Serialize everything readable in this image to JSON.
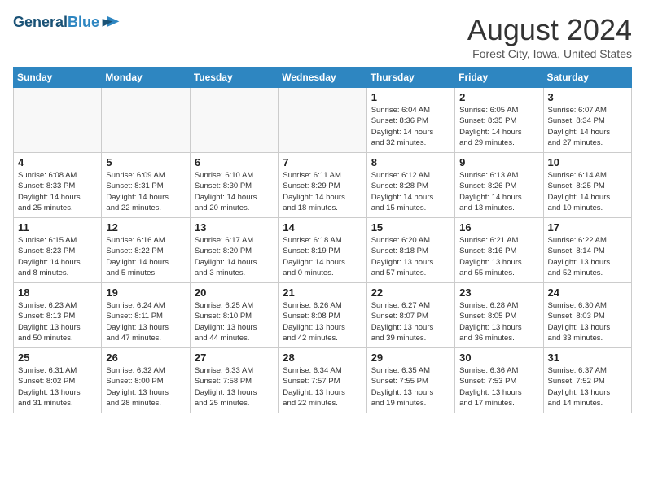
{
  "header": {
    "logo_line1": "General",
    "logo_line2": "Blue",
    "title": "August 2024",
    "location": "Forest City, Iowa, United States"
  },
  "days_of_week": [
    "Sunday",
    "Monday",
    "Tuesday",
    "Wednesday",
    "Thursday",
    "Friday",
    "Saturday"
  ],
  "weeks": [
    [
      {
        "day": "",
        "info": "",
        "empty": true
      },
      {
        "day": "",
        "info": "",
        "empty": true
      },
      {
        "day": "",
        "info": "",
        "empty": true
      },
      {
        "day": "",
        "info": "",
        "empty": true
      },
      {
        "day": "1",
        "info": "Sunrise: 6:04 AM\nSunset: 8:36 PM\nDaylight: 14 hours\nand 32 minutes."
      },
      {
        "day": "2",
        "info": "Sunrise: 6:05 AM\nSunset: 8:35 PM\nDaylight: 14 hours\nand 29 minutes."
      },
      {
        "day": "3",
        "info": "Sunrise: 6:07 AM\nSunset: 8:34 PM\nDaylight: 14 hours\nand 27 minutes."
      }
    ],
    [
      {
        "day": "4",
        "info": "Sunrise: 6:08 AM\nSunset: 8:33 PM\nDaylight: 14 hours\nand 25 minutes."
      },
      {
        "day": "5",
        "info": "Sunrise: 6:09 AM\nSunset: 8:31 PM\nDaylight: 14 hours\nand 22 minutes."
      },
      {
        "day": "6",
        "info": "Sunrise: 6:10 AM\nSunset: 8:30 PM\nDaylight: 14 hours\nand 20 minutes."
      },
      {
        "day": "7",
        "info": "Sunrise: 6:11 AM\nSunset: 8:29 PM\nDaylight: 14 hours\nand 18 minutes."
      },
      {
        "day": "8",
        "info": "Sunrise: 6:12 AM\nSunset: 8:28 PM\nDaylight: 14 hours\nand 15 minutes."
      },
      {
        "day": "9",
        "info": "Sunrise: 6:13 AM\nSunset: 8:26 PM\nDaylight: 14 hours\nand 13 minutes."
      },
      {
        "day": "10",
        "info": "Sunrise: 6:14 AM\nSunset: 8:25 PM\nDaylight: 14 hours\nand 10 minutes."
      }
    ],
    [
      {
        "day": "11",
        "info": "Sunrise: 6:15 AM\nSunset: 8:23 PM\nDaylight: 14 hours\nand 8 minutes."
      },
      {
        "day": "12",
        "info": "Sunrise: 6:16 AM\nSunset: 8:22 PM\nDaylight: 14 hours\nand 5 minutes."
      },
      {
        "day": "13",
        "info": "Sunrise: 6:17 AM\nSunset: 8:20 PM\nDaylight: 14 hours\nand 3 minutes."
      },
      {
        "day": "14",
        "info": "Sunrise: 6:18 AM\nSunset: 8:19 PM\nDaylight: 14 hours\nand 0 minutes."
      },
      {
        "day": "15",
        "info": "Sunrise: 6:20 AM\nSunset: 8:18 PM\nDaylight: 13 hours\nand 57 minutes."
      },
      {
        "day": "16",
        "info": "Sunrise: 6:21 AM\nSunset: 8:16 PM\nDaylight: 13 hours\nand 55 minutes."
      },
      {
        "day": "17",
        "info": "Sunrise: 6:22 AM\nSunset: 8:14 PM\nDaylight: 13 hours\nand 52 minutes."
      }
    ],
    [
      {
        "day": "18",
        "info": "Sunrise: 6:23 AM\nSunset: 8:13 PM\nDaylight: 13 hours\nand 50 minutes."
      },
      {
        "day": "19",
        "info": "Sunrise: 6:24 AM\nSunset: 8:11 PM\nDaylight: 13 hours\nand 47 minutes."
      },
      {
        "day": "20",
        "info": "Sunrise: 6:25 AM\nSunset: 8:10 PM\nDaylight: 13 hours\nand 44 minutes."
      },
      {
        "day": "21",
        "info": "Sunrise: 6:26 AM\nSunset: 8:08 PM\nDaylight: 13 hours\nand 42 minutes."
      },
      {
        "day": "22",
        "info": "Sunrise: 6:27 AM\nSunset: 8:07 PM\nDaylight: 13 hours\nand 39 minutes."
      },
      {
        "day": "23",
        "info": "Sunrise: 6:28 AM\nSunset: 8:05 PM\nDaylight: 13 hours\nand 36 minutes."
      },
      {
        "day": "24",
        "info": "Sunrise: 6:30 AM\nSunset: 8:03 PM\nDaylight: 13 hours\nand 33 minutes."
      }
    ],
    [
      {
        "day": "25",
        "info": "Sunrise: 6:31 AM\nSunset: 8:02 PM\nDaylight: 13 hours\nand 31 minutes."
      },
      {
        "day": "26",
        "info": "Sunrise: 6:32 AM\nSunset: 8:00 PM\nDaylight: 13 hours\nand 28 minutes."
      },
      {
        "day": "27",
        "info": "Sunrise: 6:33 AM\nSunset: 7:58 PM\nDaylight: 13 hours\nand 25 minutes."
      },
      {
        "day": "28",
        "info": "Sunrise: 6:34 AM\nSunset: 7:57 PM\nDaylight: 13 hours\nand 22 minutes."
      },
      {
        "day": "29",
        "info": "Sunrise: 6:35 AM\nSunset: 7:55 PM\nDaylight: 13 hours\nand 19 minutes."
      },
      {
        "day": "30",
        "info": "Sunrise: 6:36 AM\nSunset: 7:53 PM\nDaylight: 13 hours\nand 17 minutes."
      },
      {
        "day": "31",
        "info": "Sunrise: 6:37 AM\nSunset: 7:52 PM\nDaylight: 13 hours\nand 14 minutes."
      }
    ]
  ]
}
